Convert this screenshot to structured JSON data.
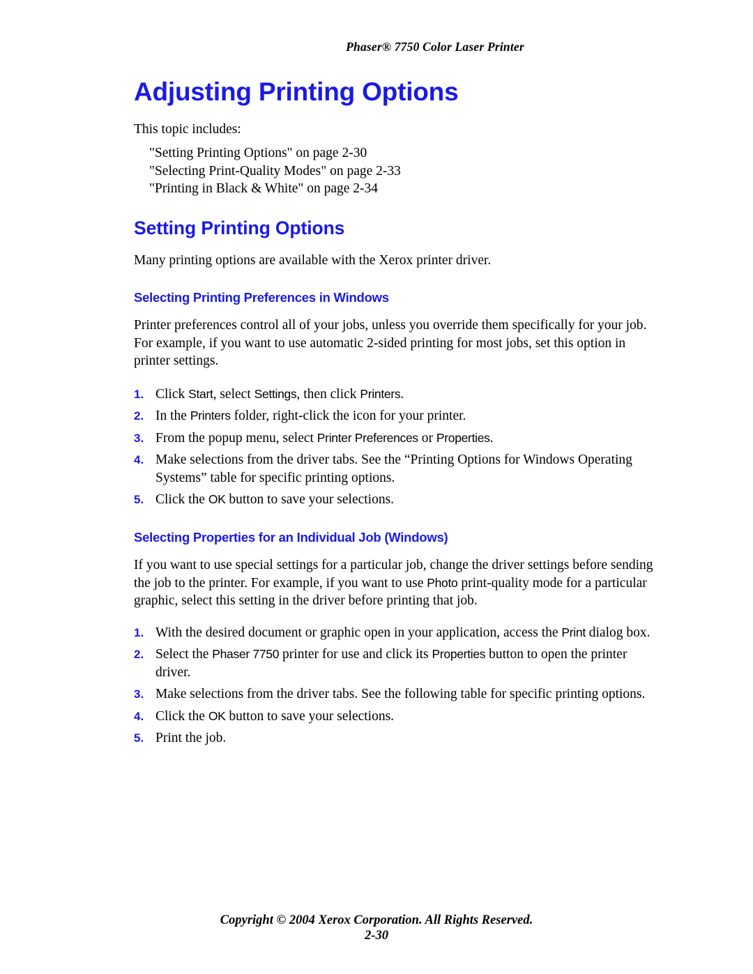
{
  "header": {
    "running_title": "Phaser® 7750 Color Laser Printer"
  },
  "chapter": {
    "title": "Adjusting Printing Options",
    "intro_lead": "This topic includes:",
    "intro_items": [
      "\"Setting Printing Options\" on page 2-30",
      "\"Selecting Print-Quality Modes\" on page 2-33",
      "\"Printing in Black & White\" on page 2-34"
    ]
  },
  "section": {
    "heading": "Setting Printing Options",
    "intro": "Many printing options are available with the Xerox printer driver."
  },
  "sub1": {
    "heading": "Selecting Printing Preferences in Windows",
    "intro": "Printer preferences control all of your jobs, unless you override them specifically for your job. For example, if you want to use automatic 2-sided printing for most jobs, set this option in printer settings.",
    "steps": [
      {
        "number": "1.",
        "parts": [
          {
            "text": "Click ",
            "ui": false
          },
          {
            "text": "Start",
            "ui": true
          },
          {
            "text": ", select ",
            "ui": false
          },
          {
            "text": "Settings",
            "ui": true
          },
          {
            "text": ", then click ",
            "ui": false
          },
          {
            "text": "Printers",
            "ui": true
          },
          {
            "text": ".",
            "ui": false
          }
        ]
      },
      {
        "number": "2.",
        "parts": [
          {
            "text": "In the ",
            "ui": false
          },
          {
            "text": "Printers",
            "ui": true
          },
          {
            "text": " folder, right-click the icon for your printer.",
            "ui": false
          }
        ]
      },
      {
        "number": "3.",
        "parts": [
          {
            "text": "From the popup menu, select ",
            "ui": false
          },
          {
            "text": "Printer Preferences",
            "ui": true
          },
          {
            "text": " or ",
            "ui": false
          },
          {
            "text": "Properties",
            "ui": true
          },
          {
            "text": ".",
            "ui": false
          }
        ]
      },
      {
        "number": "4.",
        "parts": [
          {
            "text": "Make selections from the driver tabs. See the “Printing Options for Windows Operating Systems” table for specific printing options.",
            "ui": false
          }
        ]
      },
      {
        "number": "5.",
        "parts": [
          {
            "text": "Click the ",
            "ui": false
          },
          {
            "text": "OK",
            "ui": true
          },
          {
            "text": " button to save your selections.",
            "ui": false
          }
        ]
      }
    ]
  },
  "sub2": {
    "heading": "Selecting Properties for an Individual Job (Windows)",
    "intro_parts": [
      {
        "text": "If you want to use special settings for a particular job, change the driver settings before sending the job to the printer. For example, if you want to use ",
        "ui": false
      },
      {
        "text": "Photo",
        "ui": true
      },
      {
        "text": " print-quality mode for a particular graphic, select this setting in the driver before printing that job.",
        "ui": false
      }
    ],
    "steps": [
      {
        "number": "1.",
        "parts": [
          {
            "text": "With the desired document or graphic open in your application, access the ",
            "ui": false
          },
          {
            "text": "Print",
            "ui": true
          },
          {
            "text": " dialog box.",
            "ui": false
          }
        ]
      },
      {
        "number": "2.",
        "parts": [
          {
            "text": "Select the ",
            "ui": false
          },
          {
            "text": "Phaser 7750",
            "ui": true
          },
          {
            "text": " printer for use and click its ",
            "ui": false
          },
          {
            "text": "Properties",
            "ui": true
          },
          {
            "text": " button to open the printer driver.",
            "ui": false
          }
        ]
      },
      {
        "number": "3.",
        "parts": [
          {
            "text": "Make selections from the driver tabs. See the following table for specific printing options.",
            "ui": false
          }
        ]
      },
      {
        "number": "4.",
        "parts": [
          {
            "text": "Click the ",
            "ui": false
          },
          {
            "text": "OK",
            "ui": true
          },
          {
            "text": " button to save your selections.",
            "ui": false
          }
        ]
      },
      {
        "number": "5.",
        "parts": [
          {
            "text": "Print the job.",
            "ui": false
          }
        ]
      }
    ]
  },
  "footer": {
    "copyright": "Copyright © 2004 Xerox Corporation. All Rights Reserved.",
    "page_number": "2-30"
  },
  "colors": {
    "heading_blue": "#1a1ae6",
    "body_black": "#000000",
    "page_background": "#ffffff"
  }
}
